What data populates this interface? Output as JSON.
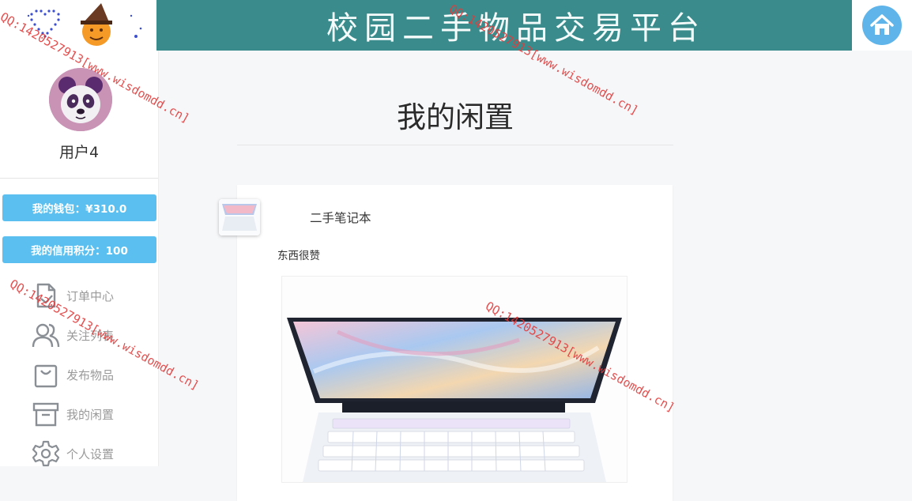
{
  "header": {
    "title": "校园二手物品交易平台"
  },
  "user": {
    "name": "用户4",
    "wallet_label": "我的钱包：¥310.0",
    "credit_label": "我的信用积分：100"
  },
  "menu": {
    "items": [
      {
        "label": "订单中心",
        "icon": "order-icon"
      },
      {
        "label": "关注列表",
        "icon": "users-icon"
      },
      {
        "label": "发布物品",
        "icon": "bag-icon"
      },
      {
        "label": "我的闲置",
        "icon": "archive-icon"
      },
      {
        "label": "个人设置",
        "icon": "gear-icon"
      }
    ]
  },
  "main": {
    "page_title": "我的闲置",
    "item": {
      "name": "二手笔记本",
      "description": "东西很赞"
    }
  },
  "watermark": {
    "text": "QQ:1420527913[www.wisdomdd.cn]"
  },
  "colors": {
    "header_bg": "#3a8c8c",
    "pill_bg": "#5bc0f0",
    "home_btn": "#5fb4e9",
    "watermark": "#e23b3b"
  }
}
